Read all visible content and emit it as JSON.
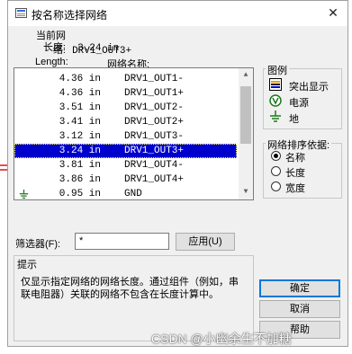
{
  "window": {
    "title": "按名称选择网络",
    "close_glyph": "✕"
  },
  "info": {
    "current_net_label": "当前网络:",
    "current_net_value": "DRV1_OUT3+",
    "length_label": "长度:",
    "length_value": "3.24 in"
  },
  "list": {
    "headers": {
      "length": "Length:",
      "name": "网络名称:"
    },
    "rows": [
      {
        "length": "4.36 in",
        "name": "DRV1_OUT1-",
        "icon": ""
      },
      {
        "length": "4.36 in",
        "name": "DRV1_OUT1+",
        "icon": ""
      },
      {
        "length": "3.51 in",
        "name": "DRV1_OUT2-",
        "icon": ""
      },
      {
        "length": "3.41 in",
        "name": "DRV1_OUT2+",
        "icon": ""
      },
      {
        "length": "3.12 in",
        "name": "DRV1_OUT3-",
        "icon": ""
      },
      {
        "length": "3.24 in",
        "name": "DRV1_OUT3+",
        "icon": "",
        "selected": true
      },
      {
        "length": "3.81 in",
        "name": "DRV1_OUT4-",
        "icon": ""
      },
      {
        "length": "3.86 in",
        "name": "DRV1_OUT4+",
        "icon": ""
      },
      {
        "length": "0.95 in",
        "name": "GND",
        "icon": "ground-icon"
      }
    ],
    "selection_color": "#0000cc"
  },
  "legend": {
    "title": "图例",
    "items": [
      {
        "label": "突出显示",
        "icon": "highlight-icon"
      },
      {
        "label": "电源",
        "icon": "power-icon"
      },
      {
        "label": "地",
        "icon": "ground-icon"
      }
    ]
  },
  "sort": {
    "title": "网络排序依据:",
    "options": [
      {
        "label": "名称",
        "selected": true
      },
      {
        "label": "长度",
        "selected": false
      },
      {
        "label": "宽度",
        "selected": false
      }
    ]
  },
  "filter": {
    "label": "筛选器(F):",
    "value": "*",
    "apply_label": "应用(U)"
  },
  "hint": {
    "title": "提示",
    "text": "仅显示指定网络的网络长度。通过组件（例如，串联电阻器）关联的网络不包含在长度计算中。"
  },
  "buttons": {
    "ok": "确定",
    "cancel": "取消",
    "help": "帮助"
  },
  "watermark": "CSDN @小幽余生不加糖"
}
